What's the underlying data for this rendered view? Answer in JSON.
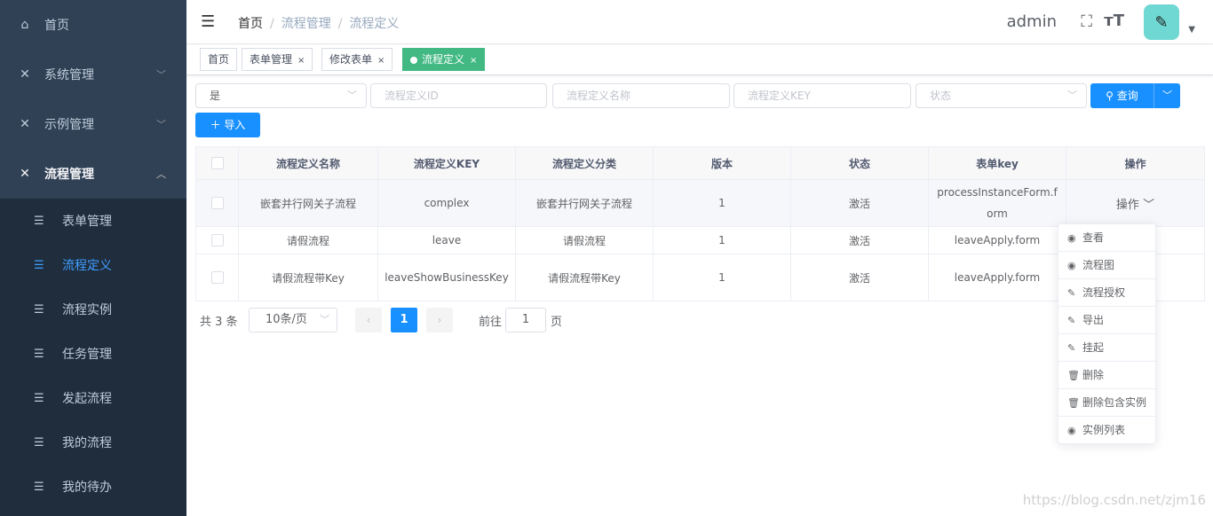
{
  "sidebar": {
    "items": [
      {
        "label": "首页",
        "icon": "home-icon"
      },
      {
        "label": "系统管理",
        "icon": "tools-icon"
      },
      {
        "label": "示例管理",
        "icon": "tools-icon"
      },
      {
        "label": "流程管理",
        "icon": "tools-icon"
      }
    ],
    "submenu": [
      {
        "label": "表单管理"
      },
      {
        "label": "流程定义",
        "active": true
      },
      {
        "label": "流程实例"
      },
      {
        "label": "任务管理"
      },
      {
        "label": "发起流程"
      },
      {
        "label": "我的流程"
      },
      {
        "label": "我的待办"
      }
    ]
  },
  "navbar": {
    "breadcrumb": [
      "首页",
      "流程管理",
      "流程定义"
    ],
    "username": "admin"
  },
  "tags": [
    {
      "label": "首页"
    },
    {
      "label": "表单管理"
    },
    {
      "label": "修改表单"
    },
    {
      "label": "流程定义",
      "active": true
    }
  ],
  "filters": {
    "latest_value": "是",
    "id_placeholder": "流程定义ID",
    "name_placeholder": "流程定义名称",
    "key_placeholder": "流程定义KEY",
    "status_placeholder": "状态",
    "search_label": "查询",
    "import_label": "导入"
  },
  "table": {
    "headers": [
      "流程定义名称",
      "流程定义KEY",
      "流程定义分类",
      "版本",
      "状态",
      "表单key",
      "操作"
    ],
    "rows": [
      [
        "嵌套并行网关子流程",
        "complex",
        "嵌套并行网关子流程",
        "1",
        "激活",
        "processInstanceForm.form",
        "操作"
      ],
      [
        "请假流程",
        "leave",
        "请假流程",
        "1",
        "激活",
        "leaveApply.form",
        ""
      ],
      [
        "请假流程带Key",
        "leaveShowBusinessKey",
        "请假流程带Key",
        "1",
        "激活",
        "leaveApply.form",
        ""
      ]
    ]
  },
  "pagination": {
    "total": "共 3 条",
    "page_size": "10条/页",
    "current_page": "1",
    "goto_prefix": "前往",
    "goto_value": "1",
    "goto_suffix": "页"
  },
  "dropdown": [
    {
      "label": "查看",
      "icon": "eye-icon"
    },
    {
      "label": "流程图",
      "icon": "eye-icon"
    },
    {
      "label": "流程授权",
      "icon": "edit-icon"
    },
    {
      "label": "导出",
      "icon": "edit-icon"
    },
    {
      "label": "挂起",
      "icon": "edit-icon"
    },
    {
      "label": "删除",
      "icon": "trash-icon"
    },
    {
      "label": "删除包含实例",
      "icon": "trash-icon"
    },
    {
      "label": "实例列表",
      "icon": "eye-icon"
    }
  ],
  "watermark": "https://blog.csdn.net/zjm16"
}
